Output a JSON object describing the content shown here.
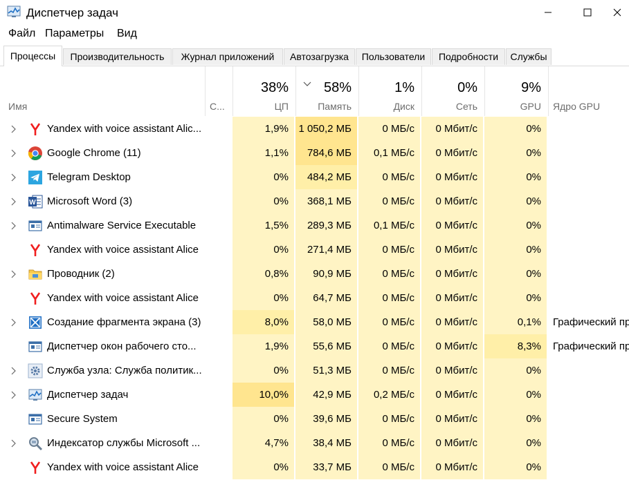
{
  "window": {
    "title": "Диспетчер задач"
  },
  "menu": [
    "Файл",
    "Параметры",
    "Вид"
  ],
  "tabs": [
    "Процессы",
    "Производительность",
    "Журнал приложений",
    "Автозагрузка",
    "Пользователи",
    "Подробности",
    "Службы"
  ],
  "columns": {
    "name": "Имя",
    "status": "С...",
    "cpu": {
      "pct": "38%",
      "label": "ЦП"
    },
    "memory": {
      "pct": "58%",
      "label": "Память"
    },
    "disk": {
      "pct": "1%",
      "label": "Диск"
    },
    "network": {
      "pct": "0%",
      "label": "Сеть"
    },
    "gpu": {
      "pct": "9%",
      "label": "GPU"
    },
    "gpu_engine": "Ядро GPU"
  },
  "processes": [
    {
      "name": "Yandex with voice assistant Alic...",
      "icon": "yandex-icon",
      "expandable": true,
      "cpu": "1,9%",
      "memory": "1 050,2 МБ",
      "disk": "0 МБ/с",
      "network": "0 Мбит/с",
      "gpu": "0%",
      "gpu_engine": ""
    },
    {
      "name": "Google Chrome (11)",
      "icon": "chrome-icon",
      "expandable": true,
      "cpu": "1,1%",
      "memory": "784,6 МБ",
      "disk": "0,1 МБ/с",
      "network": "0 Мбит/с",
      "gpu": "0%",
      "gpu_engine": ""
    },
    {
      "name": "Telegram Desktop",
      "icon": "telegram-icon",
      "expandable": true,
      "cpu": "0%",
      "memory": "484,2 МБ",
      "disk": "0 МБ/с",
      "network": "0 Мбит/с",
      "gpu": "0%",
      "gpu_engine": ""
    },
    {
      "name": "Microsoft Word (3)",
      "icon": "word-icon",
      "expandable": true,
      "cpu": "0%",
      "memory": "368,1 МБ",
      "disk": "0 МБ/с",
      "network": "0 Мбит/с",
      "gpu": "0%",
      "gpu_engine": ""
    },
    {
      "name": "Antimalware Service Executable",
      "icon": "service-window-icon",
      "expandable": true,
      "cpu": "1,5%",
      "memory": "289,3 МБ",
      "disk": "0,1 МБ/с",
      "network": "0 Мбит/с",
      "gpu": "0%",
      "gpu_engine": ""
    },
    {
      "name": "Yandex with voice assistant Alice",
      "icon": "yandex-icon",
      "expandable": false,
      "cpu": "0%",
      "memory": "271,4 МБ",
      "disk": "0 МБ/с",
      "network": "0 Мбит/с",
      "gpu": "0%",
      "gpu_engine": ""
    },
    {
      "name": "Проводник (2)",
      "icon": "explorer-folder-icon",
      "expandable": true,
      "cpu": "0,8%",
      "memory": "90,9 МБ",
      "disk": "0 МБ/с",
      "network": "0 Мбит/с",
      "gpu": "0%",
      "gpu_engine": ""
    },
    {
      "name": "Yandex with voice assistant Alice",
      "icon": "yandex-icon",
      "expandable": false,
      "cpu": "0%",
      "memory": "64,7 МБ",
      "disk": "0 МБ/с",
      "network": "0 Мбит/с",
      "gpu": "0%",
      "gpu_engine": ""
    },
    {
      "name": "Создание фрагмента экрана (3)",
      "icon": "snipping-icon",
      "expandable": true,
      "cpu": "8,0%",
      "memory": "58,0 МБ",
      "disk": "0 МБ/с",
      "network": "0 Мбит/с",
      "gpu": "0,1%",
      "gpu_engine": "Графический пр"
    },
    {
      "name": "Диспетчер окон рабочего сто...",
      "icon": "service-window-icon",
      "expandable": false,
      "cpu": "1,9%",
      "memory": "55,6 МБ",
      "disk": "0 МБ/с",
      "network": "0 Мбит/с",
      "gpu": "8,3%",
      "gpu_engine": "Графический пр"
    },
    {
      "name": "Служба узла: Служба политик...",
      "icon": "gear-icon",
      "expandable": true,
      "cpu": "0%",
      "memory": "51,3 МБ",
      "disk": "0 МБ/с",
      "network": "0 Мбит/с",
      "gpu": "0%",
      "gpu_engine": ""
    },
    {
      "name": "Диспетчер задач",
      "icon": "task-manager-icon",
      "expandable": true,
      "cpu": "10,0%",
      "memory": "42,9 МБ",
      "disk": "0,2 МБ/с",
      "network": "0 Мбит/с",
      "gpu": "0%",
      "gpu_engine": ""
    },
    {
      "name": "Secure System",
      "icon": "service-window-icon",
      "expandable": false,
      "cpu": "0%",
      "memory": "39,6 МБ",
      "disk": "0 МБ/с",
      "network": "0 Мбит/с",
      "gpu": "0%",
      "gpu_engine": ""
    },
    {
      "name": "Индексатор службы Microsoft ...",
      "icon": "indexer-icon",
      "expandable": true,
      "cpu": "4,7%",
      "memory": "38,4 МБ",
      "disk": "0 МБ/с",
      "network": "0 Мбит/с",
      "gpu": "0%",
      "gpu_engine": ""
    },
    {
      "name": "Yandex with voice assistant Alice",
      "icon": "yandex-icon",
      "expandable": false,
      "cpu": "0%",
      "memory": "33,7 МБ",
      "disk": "0 МБ/с",
      "network": "0 Мбит/с",
      "gpu": "0%",
      "gpu_engine": ""
    }
  ]
}
